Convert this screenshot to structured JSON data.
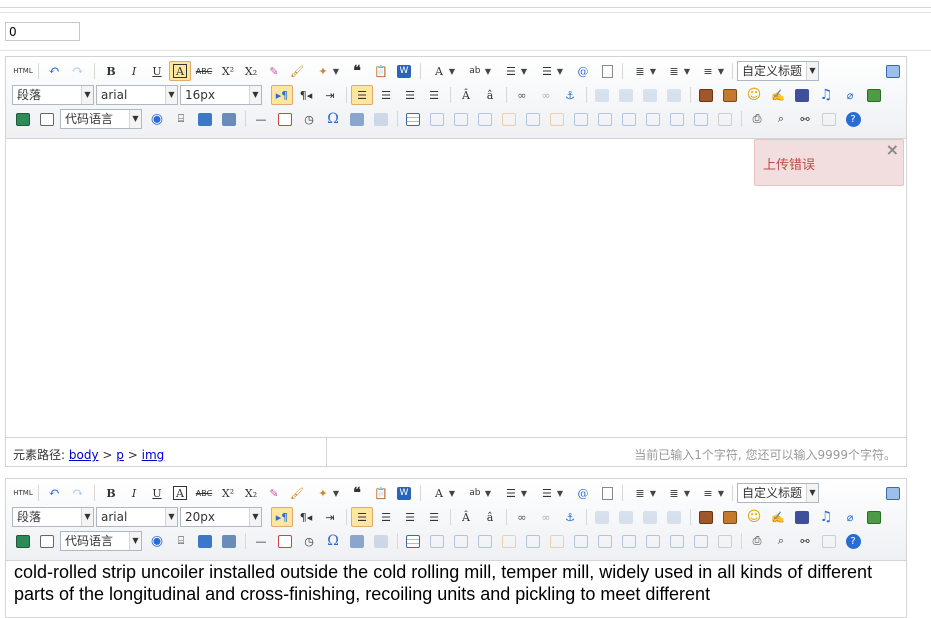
{
  "number_field": {
    "value": "0"
  },
  "editor1": {
    "toolbar": {
      "paragraph": "段落",
      "font": "arial",
      "size": "16px",
      "custom_title": "自定义标题",
      "code_lang": "代码语言"
    },
    "toast": {
      "message": "上传错误",
      "close": "×"
    },
    "status": {
      "path_label": "元素路径:",
      "path_items": [
        "body",
        "p",
        "img"
      ],
      "path_sep": ">",
      "count": "当前已输入1个字符, 您还可以输入9999个字符。"
    }
  },
  "editor2": {
    "toolbar": {
      "paragraph": "段落",
      "font": "arial",
      "size": "20px",
      "custom_title": "自定义标题",
      "code_lang": "代码语言"
    },
    "content": "cold-rolled strip uncoiler installed outside the cold rolling mill, temper mill, widely used in all kinds of different parts of the longitudinal and cross-finishing, recoiling units and pickling to meet different"
  },
  "toolbar_icons": [
    "html-source-icon",
    "undo-icon",
    "redo-icon",
    "bold-icon",
    "italic-icon",
    "underline-icon",
    "font-border-icon",
    "strikethrough-icon",
    "superscript-icon",
    "subscript-icon",
    "eraser-icon",
    "format-match-icon",
    "auto-format-icon",
    "blockquote-icon",
    "paste-text-icon",
    "word-paste-icon"
  ],
  "colors": {
    "toast_bg": "#f2dede",
    "toast_text": "#b94a48",
    "active_bg": "#ffe69f"
  }
}
